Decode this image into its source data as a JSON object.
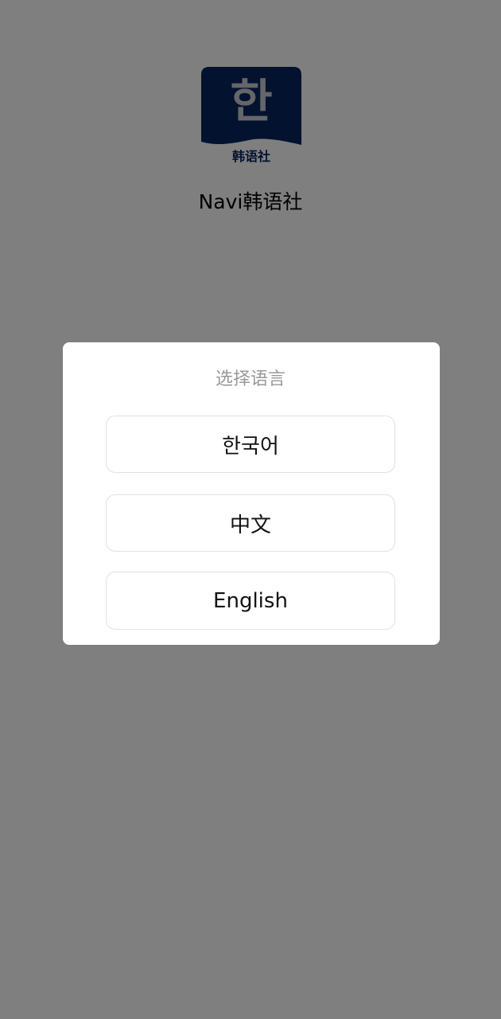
{
  "app": {
    "logo_glyph": "한",
    "logo_subtitle": "韩语社",
    "name": "Navi韩语社",
    "logo_color": "#07255f"
  },
  "language_dialog": {
    "title": "选择语言",
    "options": [
      {
        "label": "한국어"
      },
      {
        "label": "中文"
      },
      {
        "label": "English"
      }
    ]
  },
  "colors": {
    "overlay": "rgba(0,0,0,0.5)",
    "dialog_background": "#ffffff",
    "option_border": "#e1e1e1",
    "title_text": "#999999"
  }
}
